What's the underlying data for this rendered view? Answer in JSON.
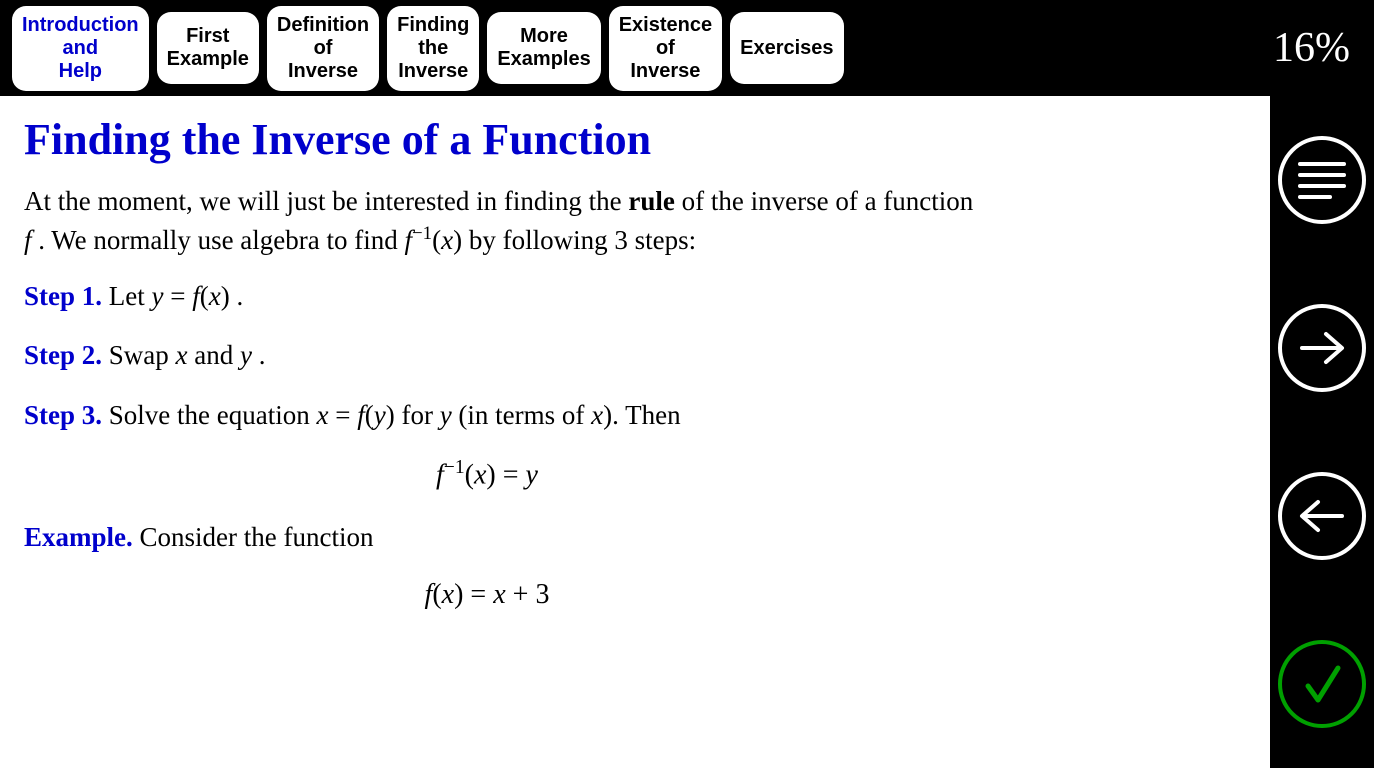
{
  "progress": "16%",
  "tabs": [
    {
      "l1": "Introduction",
      "l2": "and",
      "l3": "Help",
      "active": true
    },
    {
      "l1": "First",
      "l2": "Example",
      "l3": "",
      "active": false
    },
    {
      "l1": "Definition",
      "l2": "of",
      "l3": "Inverse",
      "active": false
    },
    {
      "l1": "Finding",
      "l2": "the",
      "l3": "Inverse",
      "active": false
    },
    {
      "l1": "More",
      "l2": "Examples",
      "l3": "",
      "active": false
    },
    {
      "l1": "Existence",
      "l2": "of",
      "l3": "Inverse",
      "active": false
    },
    {
      "l1": "Exercises",
      "l2": "",
      "l3": "",
      "active": false
    }
  ],
  "title": "Finding the Inverse of a Function",
  "intro": {
    "pre": "At the moment, we will just be interested in finding the ",
    "bold": "rule",
    "mid": " of the inverse of a function ",
    "f": "f",
    "post1": " . We normally use algebra to find ",
    "finv": "f",
    "finv_sup": "−1",
    "finv_arg": "(x)",
    "post2": " by following 3 steps:"
  },
  "steps": {
    "s1": {
      "label": "Step 1.",
      "pre": " Let ",
      "eq": "y = f(x)",
      "post": " ."
    },
    "s2": {
      "label": "Step 2.",
      "pre": " Swap ",
      "x": "x",
      "and": " and ",
      "y": "y",
      "post": " ."
    },
    "s3": {
      "label": "Step 3.",
      "pre": " Solve the equation ",
      "eq": "x = f(y)",
      "mid": " for ",
      "y": "y",
      "mid2": " (in terms of ",
      "x": "x",
      "post": ").  Then"
    },
    "s3_display": {
      "f": "f",
      "sup": "−1",
      "arg": "(x) = y"
    }
  },
  "example": {
    "label": "Example.",
    "text": "  Consider the function",
    "display": "f(x) = x + 3"
  },
  "side_icons": {
    "menu": "menu-icon",
    "next": "arrow-right-icon",
    "prev": "arrow-left-icon",
    "ok": "check-icon"
  }
}
